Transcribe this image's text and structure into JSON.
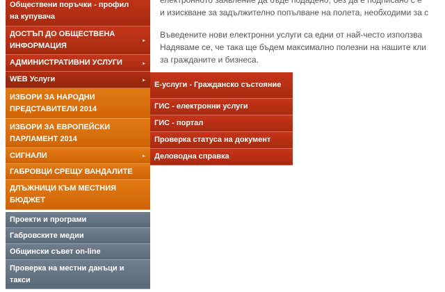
{
  "sidebar": {
    "items": [
      {
        "label": "Обществени поръчки - профил на купувача",
        "has_arrow": false
      },
      {
        "label": "ДОСТЪП ДО ОБЩЕСТВЕНА ИНФОРМАЦИЯ",
        "has_arrow": true
      },
      {
        "label": "АДМИНИСТРАТИВНИ УСЛУГИ",
        "has_arrow": true
      },
      {
        "label": "WEB Услуги",
        "has_arrow": true,
        "active": true
      },
      {
        "label": "ИЗБОРИ ЗА НАРОДНИ ПРЕДСТАВИТЕЛИ 2014",
        "has_arrow": false
      },
      {
        "label": "ИЗБОРИ ЗА ЕВРОПЕЙСКИ ПАРЛАМЕНТ 2014",
        "has_arrow": false
      },
      {
        "label": "СИГНАЛИ",
        "has_arrow": true
      },
      {
        "label": "ГАБРОВЦИ СРЕЩУ ВАНДАЛИТЕ",
        "has_arrow": false
      },
      {
        "label": "ДЛЪЖНИЦИ КЪМ МЕСТНИЯ БЮДЖЕТ",
        "has_arrow": false
      },
      {
        "label": "Проекти и програми",
        "has_arrow": false
      },
      {
        "label": "Габровските медии",
        "has_arrow": false
      },
      {
        "label": "Общински съвет on-line",
        "has_arrow": false
      },
      {
        "label": "Проверка на местни данъци и такси",
        "has_arrow": false
      }
    ],
    "arrow_glyph": "▸"
  },
  "submenu": {
    "items": [
      {
        "label": "Е-услуги - Гражданско състояние"
      },
      {
        "label": "ГИС - електронни услуги"
      },
      {
        "label": "ГИС - портал"
      },
      {
        "label": "Проверка статуса на документ"
      },
      {
        "label": "Деловодна справка"
      }
    ]
  },
  "content": {
    "lines": [
      "електронното заявление да бъде подадено, без да е подписано с е",
      "и изискване за задължително попълване на полета, необходими за с",
      "Въведените нови електронни услуги са едни от най-често използва",
      "Надяваме се, че така ще бъдем максимално полезни на нашите кли",
      "за гражданите и бизнеса."
    ]
  },
  "colors": {
    "menu_red": "#b8301a",
    "menu_orange": "#d96c0c",
    "menu_gray": "#64737f",
    "text": "#555555"
  }
}
